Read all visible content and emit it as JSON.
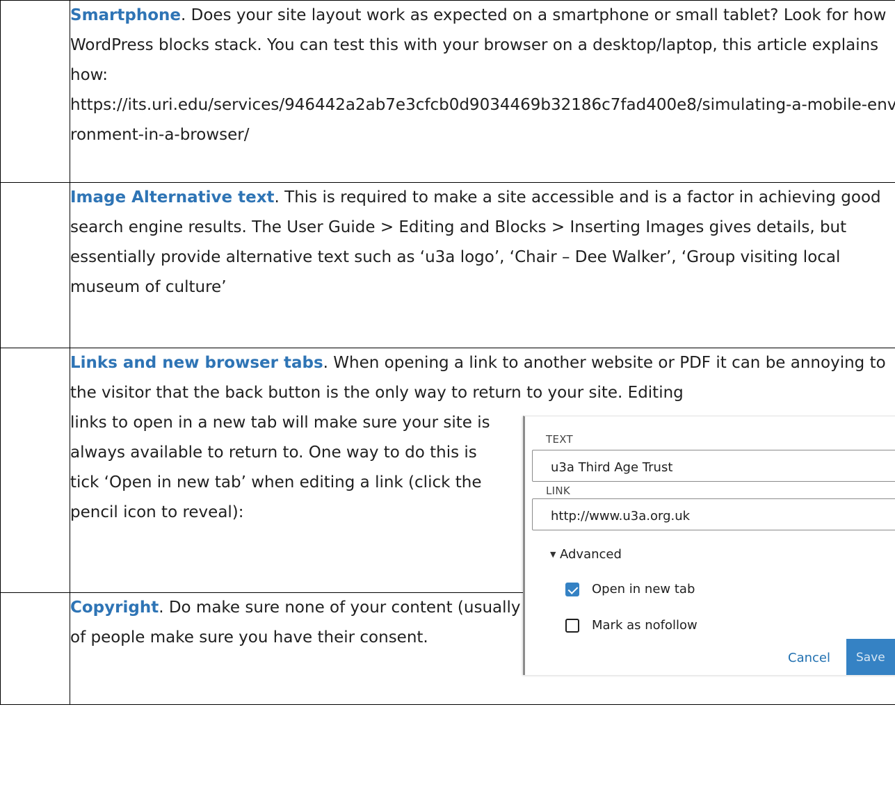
{
  "rows": [
    {
      "title": "Smartphone",
      "title_suffix": ".",
      "text": " Does your site layout work as expected on a smartphone or small tablet? Look for how WordPress blocks stack. You can test this with your browser on a desktop/laptop, this article explains how:",
      "url": "https://its.uri.edu/services/946442a2ab7e3cfcb0d9034469b32186c7fad400e8/simulating-a-mobile-environment-in-a-browser/"
    },
    {
      "title": "Image Alternative text",
      "title_suffix": ".",
      "text": " This is required to make a site accessible and is a factor in achieving good search engine results. The User Guide > Editing and Blocks > Inserting Images gives details, but essentially provide alternative text such as ‘u3a logo’, ‘Chair – Dee Walker’, ‘Group visiting local museum of culture’"
    },
    {
      "title": "Links and new browser tabs",
      "title_suffix": ".",
      "text_top": " When opening a link to another website or PDF it can be annoying to the visitor that the back button is the only way to return to your site. Editing",
      "text_side": "links to open in a new tab will make sure your site is always available to return to. One way to do this is tick ‘Open in new tab’ when editing a link (click the pencil icon to reveal):"
    },
    {
      "title": "Copyright",
      "title_suffix": ".",
      "text": " Do make sure none of your content (usually images) infringes copyrights. For photographs of people make sure you have their consent."
    }
  ],
  "link_settings": {
    "text_caption": "TEXT",
    "text_value": "u3a Third Age Trust",
    "link_caption": "LINK",
    "link_value": "http://www.u3a.org.uk",
    "advanced_label": "Advanced",
    "open_new_tab_label": "Open in new tab",
    "open_new_tab_checked": true,
    "nofollow_label": "Mark as nofollow",
    "nofollow_checked": false,
    "cancel_label": "Cancel",
    "save_label": "Save",
    "accent_color": "#3582c4"
  }
}
